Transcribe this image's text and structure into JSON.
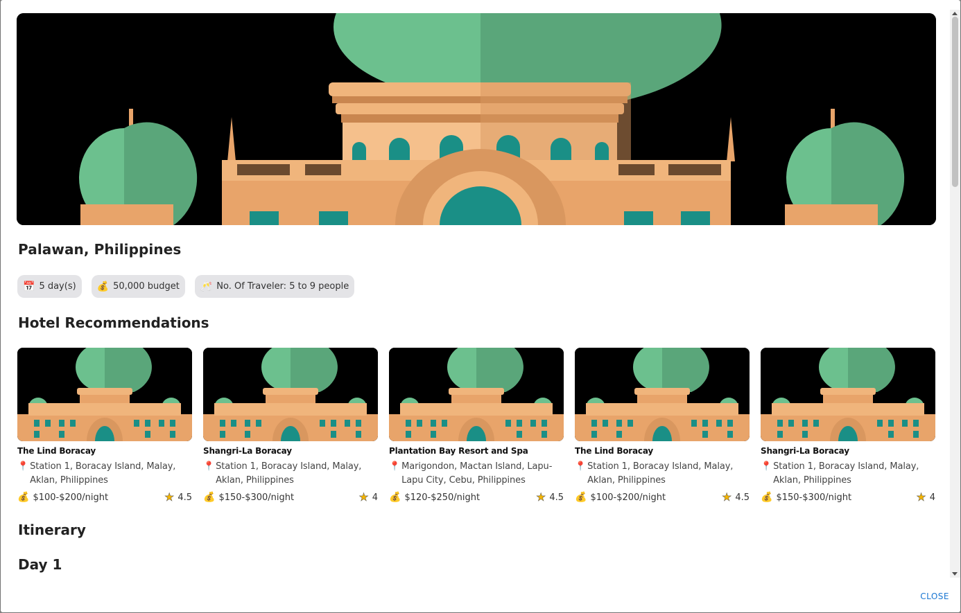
{
  "trip": {
    "title": "Palawan, Philippines",
    "chips": {
      "days": "5 day(s)",
      "budget": "50,000 budget",
      "travelers": "No. Of Traveler: 5 to 9 people"
    }
  },
  "sections": {
    "hotels": "Hotel Recommendations",
    "itinerary": "Itinerary",
    "day1": "Day 1"
  },
  "hotels": [
    {
      "name": "The Lind Boracay",
      "address": "Station 1, Boracay Island, Malay, Aklan, Philippines",
      "price": "$100-$200/night",
      "rating": "4.5"
    },
    {
      "name": "Shangri-La Boracay",
      "address": "Station 1, Boracay Island, Malay, Aklan, Philippines",
      "price": "$150-$300/night",
      "rating": "4"
    },
    {
      "name": "Plantation Bay Resort and Spa",
      "address": "Marigondon, Mactan Island, Lapu-Lapu City, Cebu, Philippines",
      "price": "$120-$250/night",
      "rating": "4.5"
    },
    {
      "name": "The Lind Boracay",
      "address": "Station 1, Boracay Island, Malay, Aklan, Philippines",
      "price": "$100-$200/night",
      "rating": "4.5"
    },
    {
      "name": "Shangri-La Boracay",
      "address": "Station 1, Boracay Island, Malay, Aklan, Philippines",
      "price": "$150-$300/night",
      "rating": "4"
    }
  ],
  "dialog": {
    "close_label": "CLOSE"
  },
  "icons": {
    "calendar": "calendar-icon",
    "money_bag": "money-bag-icon",
    "travelers": "travelers-icon",
    "pin": "location-pin-icon",
    "star": "star-icon"
  },
  "colors": {
    "accent": "#1976d2",
    "chip_bg": "#e4e4e7",
    "dome": "#6cc08e",
    "building": "#e8a46a"
  }
}
